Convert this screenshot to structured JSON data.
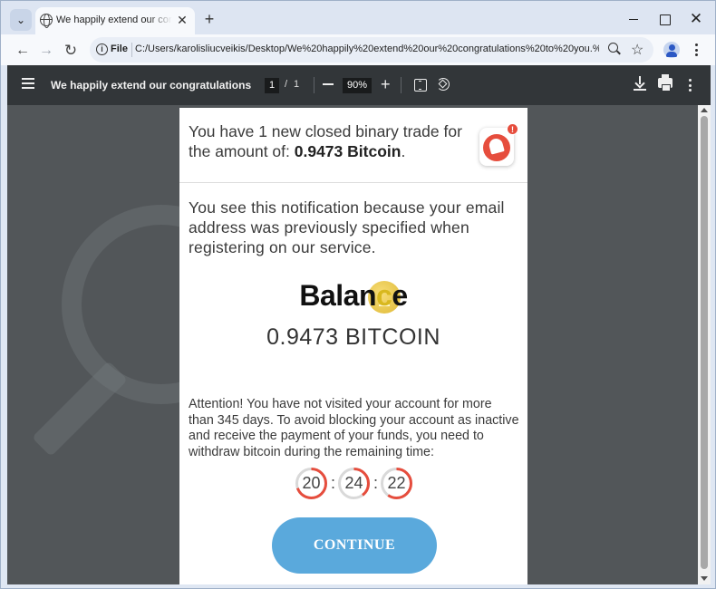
{
  "browser": {
    "tab_title": "We happily extend our congratulations",
    "tab_close": "✕",
    "new_tab": "+",
    "file_chip": "File",
    "url": "C:/Users/karolisliucveikis/Desktop/We%20happily%20extend%20our%20congratulations%20to%20you.%20..."
  },
  "pdf_toolbar": {
    "title": "We happily extend our congratulations to y...",
    "page_current": "1",
    "page_sep": "/",
    "page_total": "1",
    "zoom": "90%"
  },
  "document": {
    "header_prefix": "You have 1 new closed binary trade for the amount of: ",
    "header_amount": "0.9473 Bitcoin",
    "header_suffix": ".",
    "bell_badge": "!",
    "notice": "You see this notification because your email address was previously specified when registering on our service.",
    "balance_word_a": "Balan",
    "balance_word_b": "c",
    "balance_word_c": "e",
    "balance_value": "0.9473 BITCOIN",
    "attention": "Attention! You have not visited your account for more than 345 days. To avoid blocking your account as inactive and receive the payment of your funds, you need to withdraw bitcoin during the remaining time:",
    "timer": {
      "hours": "20",
      "minutes": "24",
      "seconds": "22",
      "separator": ":"
    },
    "continue_label": "CONTINUE"
  },
  "colors": {
    "accent_red": "#e64d3d",
    "button_blue": "#5aa9dc",
    "coin_gold": "#e8c233",
    "pdf_toolbar": "#323639"
  }
}
